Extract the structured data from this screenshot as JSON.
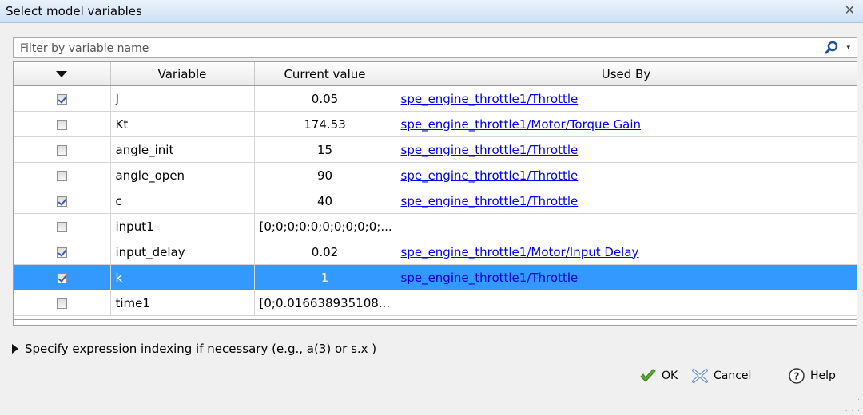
{
  "window": {
    "title": "Select model variables",
    "close_glyph": "✕"
  },
  "filter": {
    "placeholder": "Filter by variable name",
    "value": "",
    "icon": "search-icon",
    "dropdown_glyph": "▾"
  },
  "table": {
    "columns": [
      "",
      "Variable",
      "Current value",
      "Used By"
    ],
    "rows": [
      {
        "checked": true,
        "variable": "J",
        "value": "0.05",
        "used_by": "spe_engine_throttle1/Throttle",
        "selected": false
      },
      {
        "checked": false,
        "variable": "Kt",
        "value": "174.53",
        "used_by": "spe_engine_throttle1/Motor/Torque Gain",
        "selected": false
      },
      {
        "checked": false,
        "variable": "angle_init",
        "value": "15",
        "used_by": "spe_engine_throttle1/Throttle",
        "selected": false
      },
      {
        "checked": false,
        "variable": "angle_open",
        "value": "90",
        "used_by": "spe_engine_throttle1/Throttle",
        "selected": false
      },
      {
        "checked": true,
        "variable": "c",
        "value": "40",
        "used_by": "spe_engine_throttle1/Throttle",
        "selected": false
      },
      {
        "checked": false,
        "variable": "input1",
        "value": "[0;0;0;0;0;0;0;0;0;0;...",
        "used_by": "",
        "selected": false
      },
      {
        "checked": true,
        "variable": "input_delay",
        "value": "0.02",
        "used_by": "spe_engine_throttle1/Motor/Input Delay",
        "selected": false
      },
      {
        "checked": true,
        "variable": "k",
        "value": "1",
        "used_by": "spe_engine_throttle1/Throttle",
        "selected": true
      },
      {
        "checked": false,
        "variable": "time1",
        "value": "[0;0.016638935108...",
        "used_by": "",
        "selected": false
      }
    ]
  },
  "expression_hint": "Specify expression indexing if necessary (e.g., a(3) or s.x )",
  "buttons": {
    "ok": "OK",
    "cancel": "Cancel",
    "help": "Help"
  },
  "colors": {
    "selection": "#3399ff",
    "link": "#0000ee"
  }
}
